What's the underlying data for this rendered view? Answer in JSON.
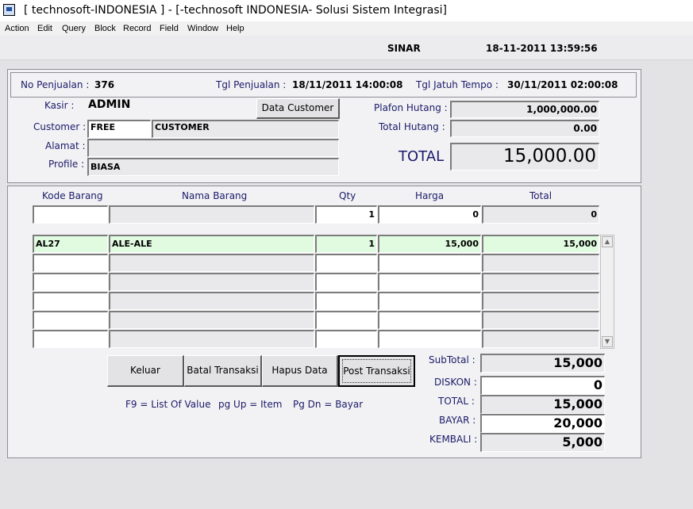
{
  "window": {
    "title": "[ technosoft-INDONESIA ] - [-technosoft INDONESIA- Solusi Sistem Integrasi]",
    "icon": "app-icon"
  },
  "menu": [
    "Action",
    "Edit",
    "Query",
    "Block",
    "Record",
    "Field",
    "Window",
    "Help"
  ],
  "status": {
    "user": "SINAR",
    "datetime": "18-11-2011 13:59:56"
  },
  "header": {
    "no_penjualan_label": "No Penjualan :",
    "no_penjualan": "376",
    "tgl_penjualan_label": "Tgl Penjualan :",
    "tgl_penjualan": "18/11/2011 14:00:08",
    "tgl_jatuh_tempo_label": "Tgl Jatuh Tempo :",
    "tgl_jatuh_tempo": "30/11/2011 02:00:08"
  },
  "customer": {
    "kasir_label": "Kasir :",
    "kasir": "ADMIN",
    "data_customer_button": "Data Customer",
    "customer_label": "Customer :",
    "customer_code": "FREE",
    "customer_name": "CUSTOMER",
    "alamat_label": "Alamat :",
    "alamat": "",
    "profile_label": "Profile :",
    "profile": "BIASA",
    "plafon_hutang_label": "Plafon Hutang :",
    "plafon_hutang": "1,000,000.00",
    "total_hutang_label": "Total Hutang :",
    "total_hutang": "0.00",
    "total_label": "TOTAL",
    "total": "15,000.00"
  },
  "items": {
    "columns": [
      "Kode Barang",
      "Nama Barang",
      "Qty",
      "Harga",
      "Total"
    ],
    "entry": {
      "kode": "",
      "nama": "",
      "qty": "1",
      "harga": "0",
      "total": "0"
    },
    "rows": [
      {
        "kode": "AL27",
        "nama": "ALE-ALE",
        "qty": "1",
        "harga": "15,000",
        "total": "15,000"
      },
      {
        "kode": "",
        "nama": "",
        "qty": "",
        "harga": "",
        "total": ""
      },
      {
        "kode": "",
        "nama": "",
        "qty": "",
        "harga": "",
        "total": ""
      },
      {
        "kode": "",
        "nama": "",
        "qty": "",
        "harga": "",
        "total": ""
      },
      {
        "kode": "",
        "nama": "",
        "qty": "",
        "harga": "",
        "total": ""
      },
      {
        "kode": "",
        "nama": "",
        "qty": "",
        "harga": "",
        "total": ""
      }
    ]
  },
  "buttons": {
    "keluar": "Keluar",
    "batal": "Batal Transaksi",
    "hapus": "Hapus Data",
    "post": "Post Transaksi"
  },
  "hints": {
    "f9": "F9 = List Of Value",
    "pgup": "pg Up = Item",
    "pgdn": "Pg Dn = Bayar"
  },
  "summary": {
    "subtotal_label": "SubTotal :",
    "subtotal": "15,000",
    "diskon_label": "DISKON :",
    "diskon": "0",
    "total_label": "TOTAL :",
    "total": "15,000",
    "bayar_label": "BAYAR :",
    "bayar": "20,000",
    "kembali_label": "KEMBALI :",
    "kembali": "5,000"
  }
}
